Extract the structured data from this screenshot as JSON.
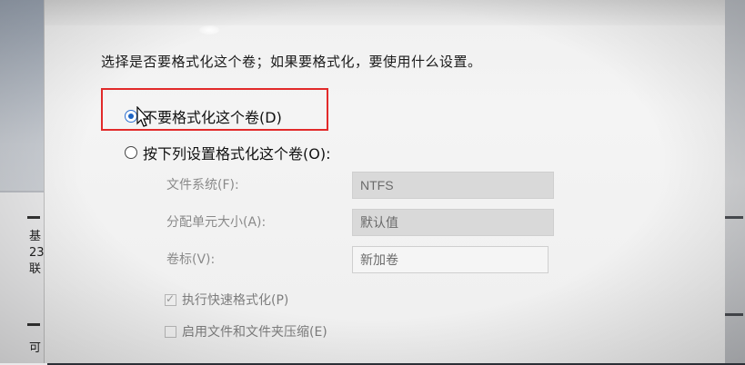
{
  "background_window": {
    "left_text_lines": [
      "基",
      "23",
      "联"
    ],
    "bottom_text": "可"
  },
  "dialog": {
    "prompt": "选择是否要格式化这个卷；如果要格式化，要使用什么设置。",
    "options": {
      "no_format": {
        "label": "不要格式化这个卷(D)",
        "selected": true
      },
      "format_with_settings": {
        "label": "按下列设置格式化这个卷(O):",
        "selected": false
      }
    },
    "fields": {
      "file_system": {
        "label": "文件系统(F):",
        "value": "NTFS"
      },
      "allocation_unit": {
        "label": "分配单元大小(A):",
        "value": "默认值"
      },
      "volume_label": {
        "label": "卷标(V):",
        "value": "新加卷"
      }
    },
    "checkboxes": {
      "quick_format": {
        "label": "执行快速格式化(P)",
        "checked": true
      },
      "compression": {
        "label": "启用文件和文件夹压缩(E)",
        "checked": false
      }
    }
  },
  "colors": {
    "highlight": "#e22a2a",
    "radio_accent": "#1c63c4",
    "disabled_text": "#8a8a8a"
  }
}
